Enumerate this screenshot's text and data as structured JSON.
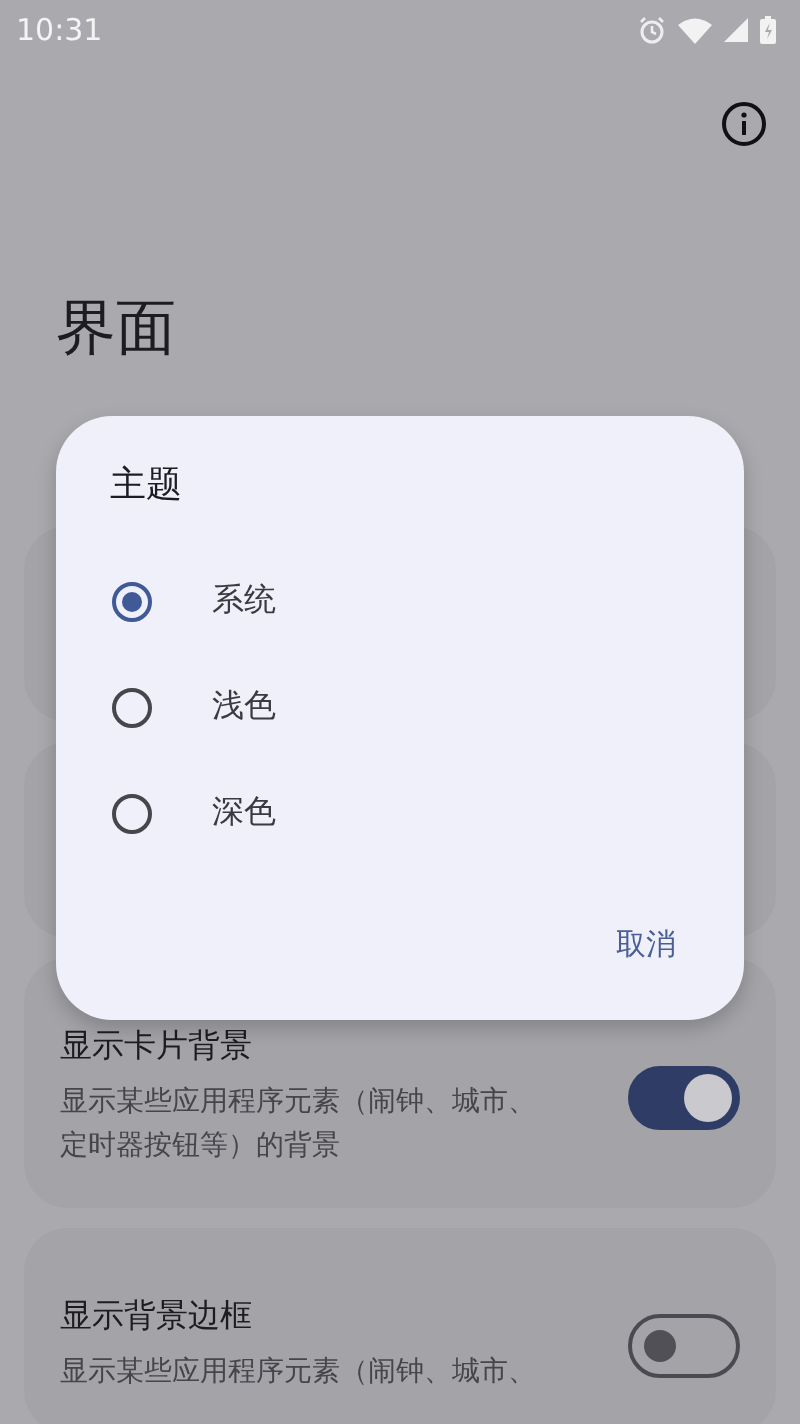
{
  "status_bar": {
    "time": "10:31"
  },
  "page": {
    "title": "界面"
  },
  "settings": [
    {
      "kind": "blank"
    },
    {
      "kind": "blank"
    },
    {
      "kind": "toggle",
      "title": "显示卡片背景",
      "description": "显示某些应用程序元素（闹钟、城市、定时器按钮等）的背景",
      "on": true
    },
    {
      "kind": "toggle",
      "title": "显示背景边框",
      "description": "显示某些应用程序元素（闹钟、城市、",
      "on": false
    }
  ],
  "dialog": {
    "title": "主题",
    "options": [
      {
        "label": "系统",
        "selected": true
      },
      {
        "label": "浅色",
        "selected": false
      },
      {
        "label": "深色",
        "selected": false
      }
    ],
    "buttons": [
      "取消"
    ]
  }
}
